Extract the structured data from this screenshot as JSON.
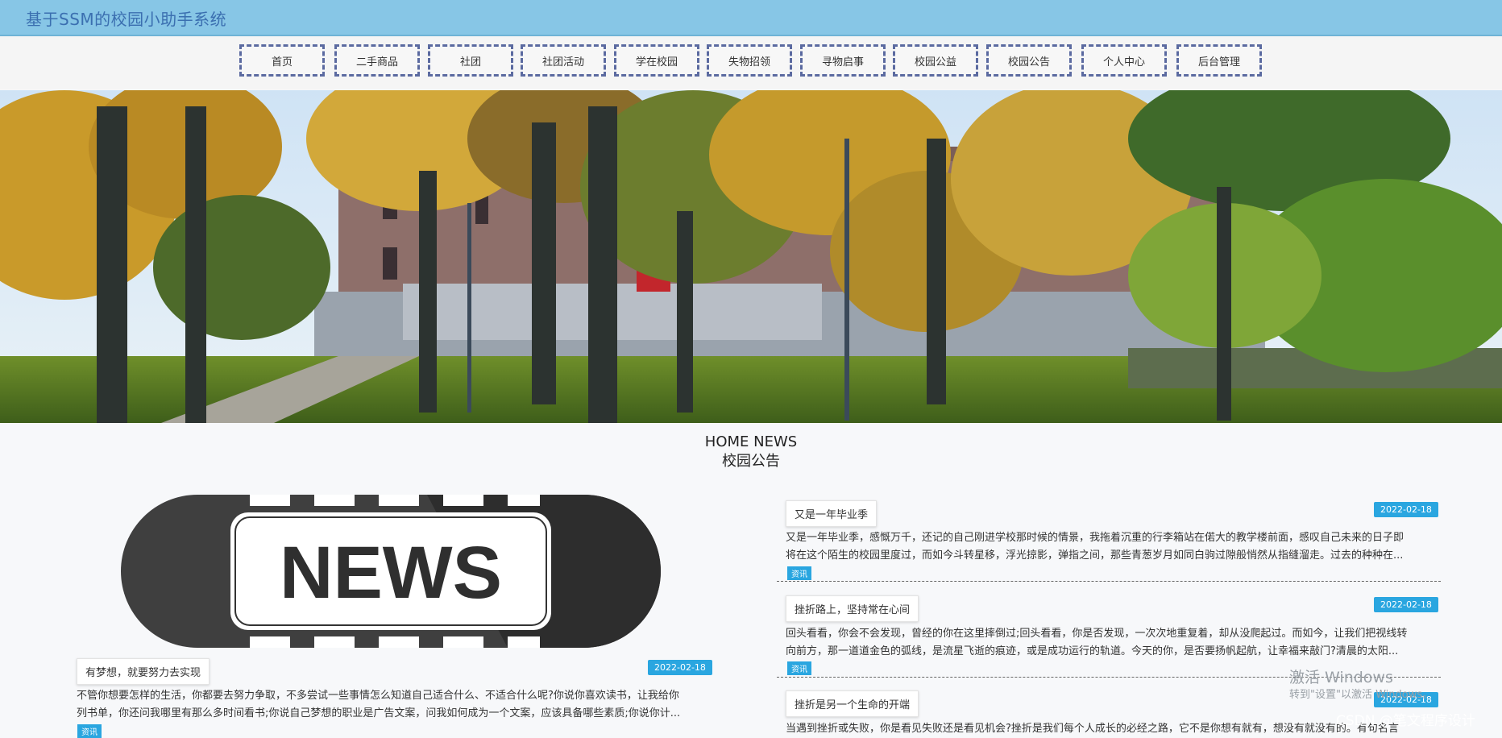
{
  "app": {
    "title": "基于SSM的校园小助手系统"
  },
  "nav": [
    {
      "label": "首页"
    },
    {
      "label": "二手商品"
    },
    {
      "label": "社团"
    },
    {
      "label": "社团活动"
    },
    {
      "label": "学在校园"
    },
    {
      "label": "失物招领"
    },
    {
      "label": "寻物启事"
    },
    {
      "label": "校园公益"
    },
    {
      "label": "校园公告"
    },
    {
      "label": "个人中心"
    },
    {
      "label": "后台管理"
    }
  ],
  "banner": {
    "slides": 3,
    "active": 1
  },
  "section": {
    "en": "HOME NEWS",
    "cn": "校园公告"
  },
  "featured": {
    "image_text": "NEWS",
    "title": "有梦想，就要努力去实现",
    "date": "2022-02-18",
    "excerpt_line1": "不管你想要怎样的生活，你都要去努力争取，不多尝试一些事情怎么知道自己适合什么、不适合什么呢?你说你喜欢读书，让我给你",
    "excerpt_line2": "列书单，你还问我哪里有那么多时间看书;你说自己梦想的职业是广告文案，问我如何成为一个文案，应该具备哪些素质;你说你计...",
    "tag": "资讯"
  },
  "news": [
    {
      "title": "又是一年毕业季",
      "date": "2022-02-18",
      "line1": "又是一年毕业季，感慨万千，还记的自己刚进学校那时候的情景，我拖着沉重的行李箱站在偌大的教学楼前面，感叹自己未来的日子即",
      "line2": "将在这个陌生的校园里度过，而如今斗转星移，浮光掠影，弹指之间，那些青葱岁月如同白驹过隙般悄然从指缝溜走。过去的种种在...",
      "tag": "资讯"
    },
    {
      "title": "挫折路上，坚持常在心间",
      "date": "2022-02-18",
      "line1": "回头看看，你会不会发现，曾经的你在这里摔倒过;回头看看，你是否发现，一次次地重复着，却从没爬起过。而如今，让我们把视线转",
      "line2": "向前方，那一道道金色的弧线，是流星飞逝的痕迹，或是成功运行的轨道。今天的你，是否要扬帆起航，让幸福来敲门?清晨的太阳...",
      "tag": "资讯"
    },
    {
      "title": "挫折是另一个生命的开端",
      "date": "2022-02-18",
      "line1": "当遇到挫折或失败，你是看见失败还是看见机会?挫折是我们每个人成长的必经之路，它不是你想有就有，想没有就没有的。有句名言"
    }
  ],
  "watermark": {
    "line1": "激活 Windows",
    "line2": "转到\"设置\"以激活 Windows。"
  },
  "credit": "CSDN @笔文程序设计",
  "colors": {
    "topbar": "#87c6e6",
    "accent": "#2aa6e0",
    "nav_border": "#5b6aa0"
  }
}
